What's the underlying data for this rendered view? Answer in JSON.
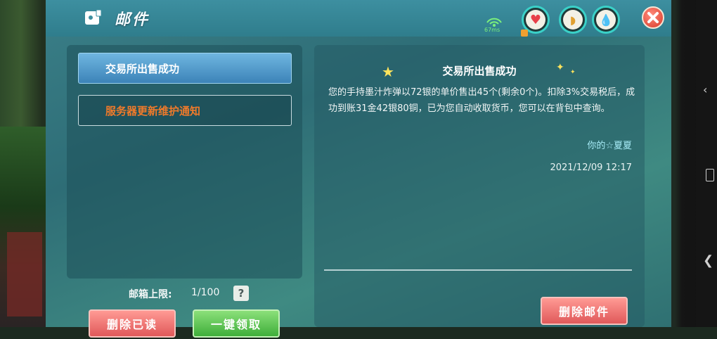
{
  "header": {
    "title": "邮件",
    "ping": "67ms"
  },
  "stats": [
    {
      "name": "health",
      "icon": "heart-icon",
      "color": "#e8404a"
    },
    {
      "name": "hunger",
      "icon": "stomach-icon",
      "color": "#e0a030"
    },
    {
      "name": "thirst",
      "icon": "water-drop-icon",
      "color": "#2a8a8a"
    }
  ],
  "mail_list": {
    "items": [
      {
        "label": "交易所出售成功",
        "selected": true
      },
      {
        "label": "服务器更新维护通知",
        "selected": false
      }
    ],
    "capacity_label": "邮箱上限:",
    "capacity_value": "1/100",
    "help": "?",
    "delete_read": "删除已读",
    "claim_all": "一键领取"
  },
  "detail": {
    "title": "交易所出售成功",
    "body": "您的手持墨汁炸弹以72银的单价售出45个(剩余0个)。扣除3%交易税后，成功到账31金42银80铜，已为您自动收取货币，您可以在背包中查询。",
    "sender": "你的☆夏夏",
    "timestamp": "2021/12/09 12:17",
    "delete": "删除邮件"
  }
}
